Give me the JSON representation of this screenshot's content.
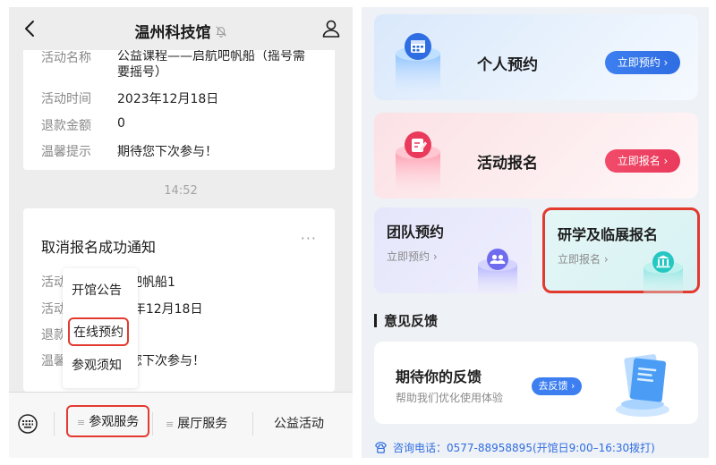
{
  "left": {
    "title": "温州科技馆",
    "card1": {
      "rows": [
        {
          "label": "活动名称",
          "value": "公益课程——启航吧帆船（摇号需要摇号）"
        },
        {
          "label": "活动时间",
          "value": "2023年12月18日"
        },
        {
          "label": "退款金额",
          "value": "0"
        },
        {
          "label": "温馨提示",
          "value": "期待您下次参与！"
        }
      ]
    },
    "timestamp": "14:52",
    "card2": {
      "title": "取消报名成功通知",
      "more": "···",
      "rows": [
        {
          "label": "活动",
          "value": "航吧帆船1"
        },
        {
          "label": "活动",
          "value": "23年12月18日"
        },
        {
          "label": "退款",
          "value": ""
        },
        {
          "label": "温馨",
          "value": "待您下次参与！"
        }
      ]
    },
    "popup": {
      "items": [
        "开馆公告",
        "在线预约",
        "参观须知"
      ]
    },
    "bottom_menu": {
      "items": [
        "参观服务",
        "展厅服务",
        "公益活动"
      ],
      "menu_glyph": "≡"
    }
  },
  "right": {
    "personal": {
      "title": "个人预约",
      "button": "立即预约 ›"
    },
    "activity": {
      "title": "活动报名",
      "button": "立即报名 ›"
    },
    "team": {
      "title": "团队预约",
      "link": "立即预约 ›"
    },
    "study": {
      "title": "研学及临展报名",
      "link": "立即报名 ›"
    },
    "feedback_section": "意见反馈",
    "feedback_card": {
      "heading": "期待你的反馈",
      "sub": "帮助我们优化使用体验",
      "button": "去反馈 ›"
    },
    "phone": "咨询电话：0577-88958895(开馆日9:00–16:30拨打)"
  },
  "colors": {
    "accent_blue": "#2f6de2",
    "accent_red": "#e93a5c",
    "highlight_border": "#e33a30",
    "teal": "#25c7c2",
    "purple": "#6f6cf0"
  }
}
